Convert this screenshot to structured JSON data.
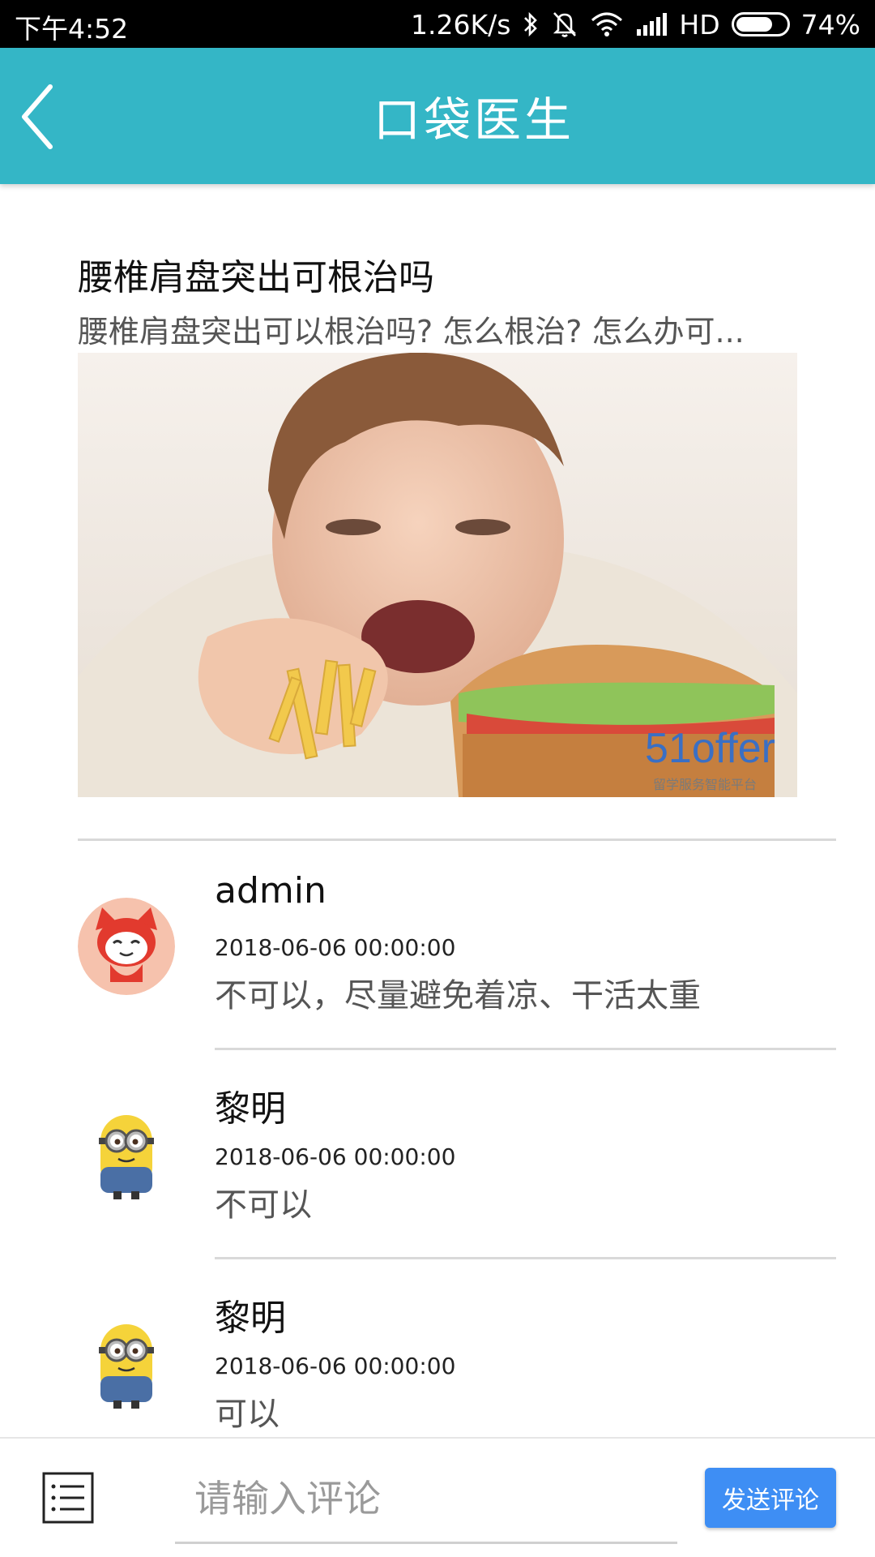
{
  "status_bar": {
    "time": "下午4:52",
    "net_speed": "1.26K/s",
    "network_label": "HD",
    "battery_percent": "74%",
    "battery_level": 0.74,
    "icons": [
      "bluetooth-icon",
      "mute-bell-icon",
      "wifi-icon",
      "signal-icon",
      "battery-icon"
    ]
  },
  "header": {
    "title": "口袋医生",
    "back_icon": "chevron-left-icon",
    "color": "#34b6c6"
  },
  "article": {
    "title": "腰椎肩盘突出可根治吗",
    "summary": "腰椎肩盘突出可以根治吗? 怎么根治? 怎么办可...",
    "image_watermark": "51offer",
    "image_watermark_sub": "留学服务智能平台"
  },
  "comments": [
    {
      "name": "admin",
      "time": "2018-06-06 00:00:00",
      "text": "不可以，尽量避免着凉、干活太重",
      "avatar": "red-fox-cartoon-avatar"
    },
    {
      "name": "黎明",
      "time": "2018-06-06 00:00:00",
      "text": "不可以",
      "avatar": "minion-avatar"
    },
    {
      "name": "黎明",
      "time": "2018-06-06 00:00:00",
      "text": "可以",
      "avatar": "minion-avatar"
    }
  ],
  "bottom_bar": {
    "input_placeholder": "请输入评论",
    "send_label": "发送评论",
    "menu_icon": "list-icon",
    "send_color": "#3e8ef4"
  }
}
